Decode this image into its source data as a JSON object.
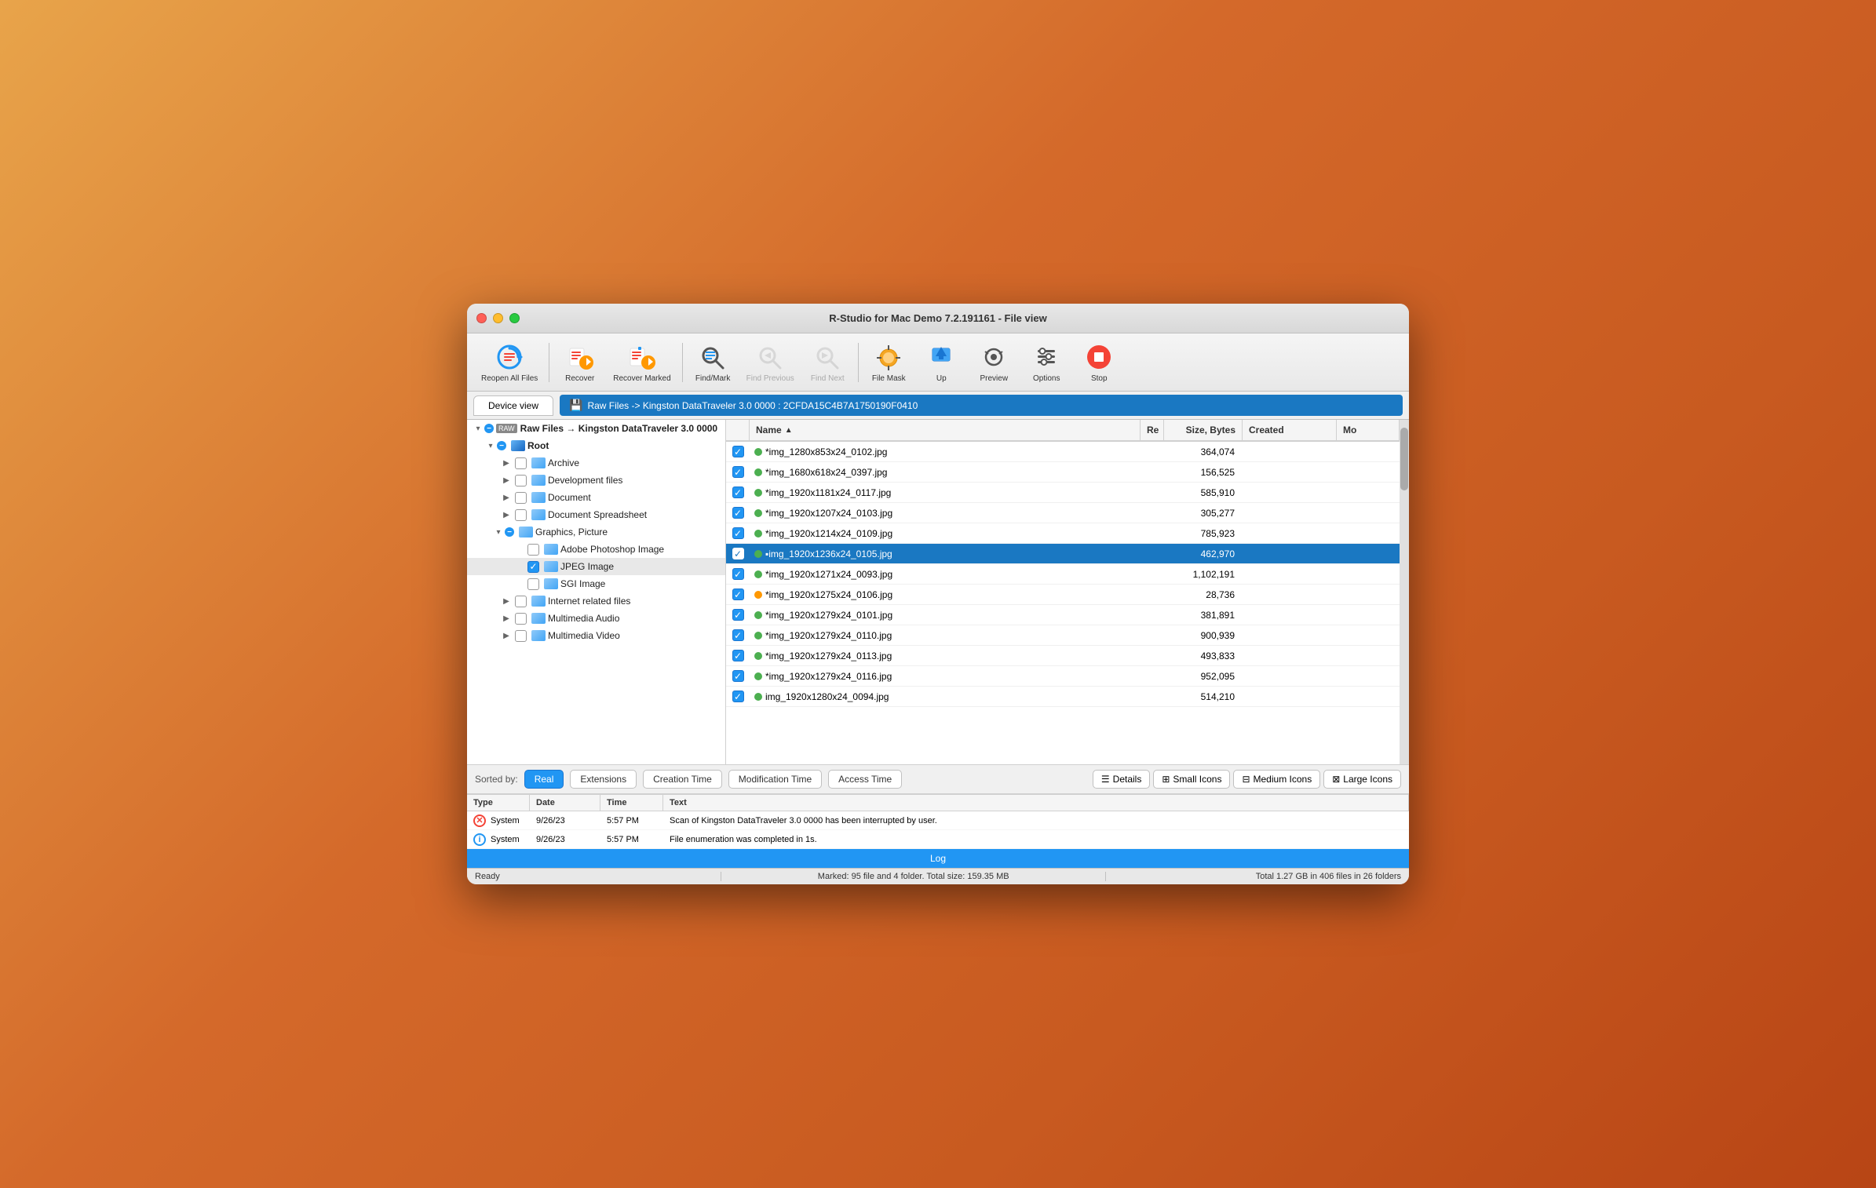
{
  "window": {
    "title": "R-Studio for Mac Demo 7.2.191161 - File view"
  },
  "toolbar": {
    "buttons": [
      {
        "id": "reopen-all-files",
        "label": "Reopen All Files",
        "enabled": true
      },
      {
        "id": "recover",
        "label": "Recover",
        "enabled": true
      },
      {
        "id": "recover-marked",
        "label": "Recover Marked",
        "enabled": true
      },
      {
        "id": "find-mark",
        "label": "Find/Mark",
        "enabled": true
      },
      {
        "id": "find-previous",
        "label": "Find Previous",
        "enabled": false
      },
      {
        "id": "find-next",
        "label": "Find Next",
        "enabled": false
      },
      {
        "id": "file-mask",
        "label": "File Mask",
        "enabled": true
      },
      {
        "id": "up",
        "label": "Up",
        "enabled": true
      },
      {
        "id": "preview",
        "label": "Preview",
        "enabled": true
      },
      {
        "id": "options",
        "label": "Options",
        "enabled": true
      },
      {
        "id": "stop",
        "label": "Stop",
        "enabled": true
      }
    ]
  },
  "nav": {
    "device_view_label": "Device view",
    "path_label": "Raw Files -> Kingston DataTraveler 3.0 0000 : 2CFDA15C4B7A1750190F0410"
  },
  "tree": {
    "root_label": "Raw Files → Kingston DataTraveler 3.0 0000",
    "items": [
      {
        "id": "root",
        "label": "Root",
        "depth": 1,
        "expanded": true,
        "checked": "partial"
      },
      {
        "id": "archive",
        "label": "Archive",
        "depth": 2,
        "expanded": false,
        "checked": "none"
      },
      {
        "id": "dev-files",
        "label": "Development files",
        "depth": 2,
        "expanded": false,
        "checked": "none"
      },
      {
        "id": "document",
        "label": "Document",
        "depth": 2,
        "expanded": false,
        "checked": "none"
      },
      {
        "id": "doc-spreadsheet",
        "label": "Document Spreadsheet",
        "depth": 2,
        "expanded": false,
        "checked": "none"
      },
      {
        "id": "graphics-picture",
        "label": "Graphics, Picture",
        "depth": 2,
        "expanded": true,
        "checked": "partial"
      },
      {
        "id": "adobe-photoshop",
        "label": "Adobe Photoshop Image",
        "depth": 3,
        "expanded": false,
        "checked": "none"
      },
      {
        "id": "jpeg-image",
        "label": "JPEG Image",
        "depth": 3,
        "expanded": false,
        "checked": "checked",
        "selected": true
      },
      {
        "id": "sgi-image",
        "label": "SGI Image",
        "depth": 3,
        "expanded": false,
        "checked": "none"
      },
      {
        "id": "internet-files",
        "label": "Internet related files",
        "depth": 2,
        "expanded": false,
        "checked": "none"
      },
      {
        "id": "multimedia-audio",
        "label": "Multimedia Audio",
        "depth": 2,
        "expanded": false,
        "checked": "none"
      },
      {
        "id": "multimedia-video",
        "label": "Multimedia Video",
        "depth": 2,
        "expanded": false,
        "checked": "none"
      }
    ]
  },
  "file_list": {
    "columns": [
      "Name",
      "Re",
      "Size, Bytes",
      "Created",
      "Mo"
    ],
    "files": [
      {
        "name": "*img_1280x853x24_0102.jpg",
        "status": "green",
        "size": "364,074",
        "created": "",
        "modified": ""
      },
      {
        "name": "*img_1680x618x24_0397.jpg",
        "status": "green",
        "size": "156,525",
        "created": "",
        "modified": ""
      },
      {
        "name": "*img_1920x1181x24_0117.jpg",
        "status": "green",
        "size": "585,910",
        "created": "",
        "modified": ""
      },
      {
        "name": "*img_1920x1207x24_0103.jpg",
        "status": "green",
        "size": "305,277",
        "created": "",
        "modified": ""
      },
      {
        "name": "*img_1920x1214x24_0109.jpg",
        "status": "green",
        "size": "785,923",
        "created": "",
        "modified": ""
      },
      {
        "name": "▪img_1920x1236x24_0105.jpg",
        "status": "green",
        "size": "462,970",
        "created": "",
        "modified": "",
        "selected": true
      },
      {
        "name": "*img_1920x1271x24_0093.jpg",
        "status": "green",
        "size": "1,102,191",
        "created": "",
        "modified": ""
      },
      {
        "name": "*img_1920x1275x24_0106.jpg",
        "status": "orange",
        "size": "28,736",
        "created": "",
        "modified": ""
      },
      {
        "name": "*img_1920x1279x24_0101.jpg",
        "status": "green",
        "size": "381,891",
        "created": "",
        "modified": ""
      },
      {
        "name": "*img_1920x1279x24_0110.jpg",
        "status": "green",
        "size": "900,939",
        "created": "",
        "modified": ""
      },
      {
        "name": "*img_1920x1279x24_0113.jpg",
        "status": "green",
        "size": "493,833",
        "created": "",
        "modified": ""
      },
      {
        "name": "*img_1920x1279x24_0116.jpg",
        "status": "green",
        "size": "952,095",
        "created": "",
        "modified": ""
      },
      {
        "name": "img_1920x1280x24_0094.jpg",
        "status": "green",
        "size": "514,210",
        "created": "",
        "modified": ""
      }
    ]
  },
  "sort_bar": {
    "label": "Sorted by:",
    "buttons": [
      {
        "id": "real",
        "label": "Real",
        "active": true
      },
      {
        "id": "extensions",
        "label": "Extensions",
        "active": false
      },
      {
        "id": "creation-time",
        "label": "Creation Time",
        "active": false
      },
      {
        "id": "modification-time",
        "label": "Modification Time",
        "active": false
      },
      {
        "id": "access-time",
        "label": "Access Time",
        "active": false
      }
    ],
    "view_buttons": [
      {
        "id": "details",
        "label": "Details",
        "icon": "☰"
      },
      {
        "id": "small-icons",
        "label": "Small Icons",
        "icon": "⊞"
      },
      {
        "id": "medium-icons",
        "label": "Medium Icons",
        "icon": "⊟"
      },
      {
        "id": "large-icons",
        "label": "Large Icons",
        "icon": "⊠"
      }
    ]
  },
  "log": {
    "toggle_label": "Log",
    "columns": [
      "Type",
      "Date",
      "Time",
      "Text"
    ],
    "rows": [
      {
        "type": "error",
        "icon": "✕",
        "type_label": "System",
        "date": "9/26/23",
        "time": "5:57 PM",
        "text": "Scan of Kingston DataTraveler 3.0 0000 has been interrupted by user."
      },
      {
        "type": "info",
        "icon": "i",
        "type_label": "System",
        "date": "9/26/23",
        "time": "5:57 PM",
        "text": "File enumeration was completed in 1s."
      }
    ]
  },
  "status_bar": {
    "ready": "Ready",
    "marked": "Marked: 95 file and 4 folder. Total size: 159.35 MB",
    "total": "Total 1.27 GB in 406 files in 26 folders"
  }
}
